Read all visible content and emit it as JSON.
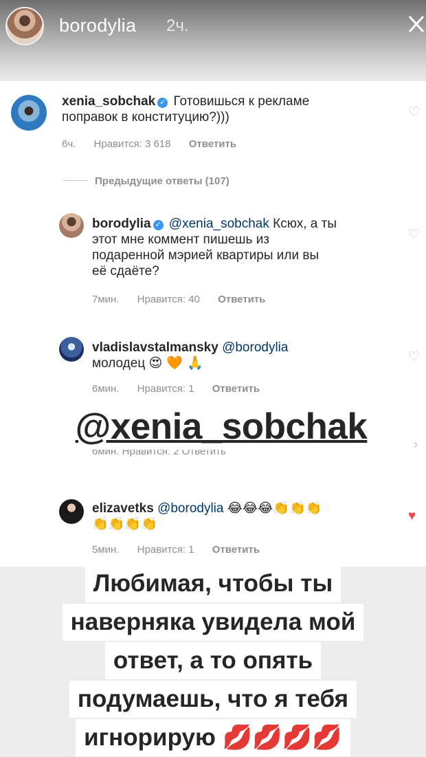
{
  "story": {
    "username": "borodylia",
    "time": "2ч.",
    "close_icon": "close-icon"
  },
  "comments": [
    {
      "username": "xenia_sobchak",
      "verified": true,
      "text": "Готовишься к рекламе поправок в конституцию?)))",
      "text_line1": "Готовишься к рекламе",
      "text_line2": "поправок в конституцию?)))",
      "time": "6ч.",
      "likes": "Нравится: 3 618",
      "reply": "Ответить",
      "liked": false
    },
    {
      "previous_replies": "Предыдущие ответы (107)"
    },
    {
      "username": "borodylia",
      "verified": true,
      "mention": "@xenia_sobchak",
      "text_after_mention": "Ксюх, а ты",
      "text_line2": "этот мне коммент пишешь из",
      "text_line3": "подаренной мэрией квартиры или вы",
      "text_line4": "её сдаёте?",
      "time": "7мин.",
      "likes": "Нравится: 40",
      "reply": "Ответить",
      "liked": false
    },
    {
      "username": "vladislavstalmansky",
      "mention": "@borodylia",
      "text": "молодец",
      "emojis": "😍 🧡 🙏",
      "time": "6мин.",
      "likes": "Нравится: 1",
      "reply": "Ответить",
      "liked": false
    },
    {
      "partial_meta": "6мин.   Нравится: 2   Ответить"
    },
    {
      "username": "elizavetks",
      "mention": "@borodylia",
      "emojis_line1": "😂😂😂👏👏👏",
      "emojis_line2": "👏👏👏👏",
      "time": "5мин.",
      "likes": "Нравится: 1",
      "reply": "Ответить",
      "liked": true
    }
  ],
  "mention_sticker": "@xenia_sobchak",
  "caption": {
    "line1": "Любимая, чтобы ты",
    "line2": "наверняка увидела мой",
    "line3": "ответ, а то опять",
    "line4": "подумаешь, что я тебя",
    "line5": "игнорирую",
    "emojis": "💋💋💋💋"
  },
  "colors": {
    "mention": "#00376b",
    "meta": "#8e8e8e",
    "liked_heart": "#ed4956",
    "verified": "#3897f0"
  }
}
